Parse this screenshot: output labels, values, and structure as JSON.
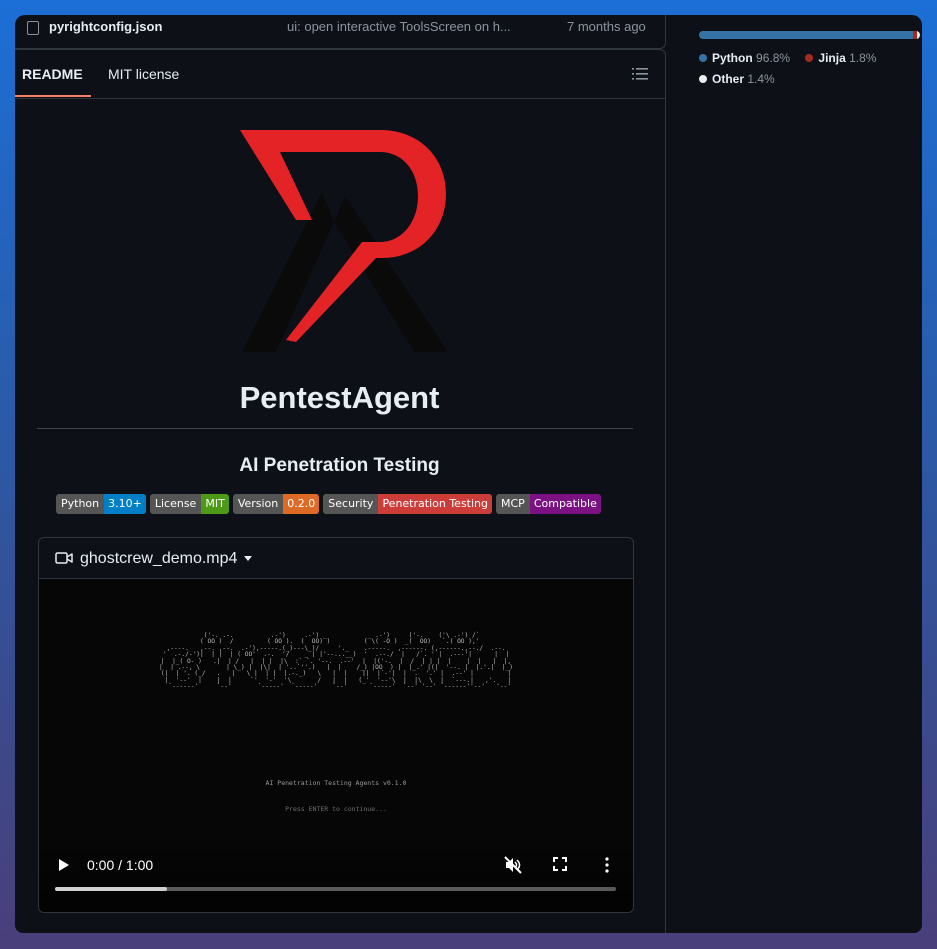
{
  "top_file": {
    "name": "pyrightconfig.json",
    "message": "ui: open interactive ToolsScreen on h...",
    "time": "7 months ago"
  },
  "tabs": {
    "readme": "README",
    "license": "MIT license"
  },
  "readme": {
    "title": "PentestAgent",
    "subtitle": "AI Penetration Testing",
    "badges": [
      {
        "label": "Python",
        "value": "3.10+",
        "color": "#007ec6"
      },
      {
        "label": "License",
        "value": "MIT",
        "color": "#4c9a16"
      },
      {
        "label": "Version",
        "value": "0.2.0",
        "color": "#dd6b26"
      },
      {
        "label": "Security",
        "value": "Penetration Testing",
        "color": "#cc3d3a"
      },
      {
        "label": "MCP",
        "value": "Compatible",
        "color": "#7b1182"
      }
    ]
  },
  "video": {
    "filename": "ghostcrew_demo.mp4",
    "ascii_caption": "AI Penetration Testing Agents  v0.1.0",
    "press_text": "Press ENTER to continue...",
    "time": "0:00 / 1:00",
    "progress": 0.2
  },
  "languages": [
    {
      "name": "Python",
      "pct": "96.8%",
      "value": 96.8,
      "color": "#3572A5"
    },
    {
      "name": "Jinja",
      "pct": "1.8%",
      "value": 1.8,
      "color": "#a52a22"
    },
    {
      "name": "Other",
      "pct": "1.4%",
      "value": 1.4,
      "color": "#ededed"
    }
  ]
}
